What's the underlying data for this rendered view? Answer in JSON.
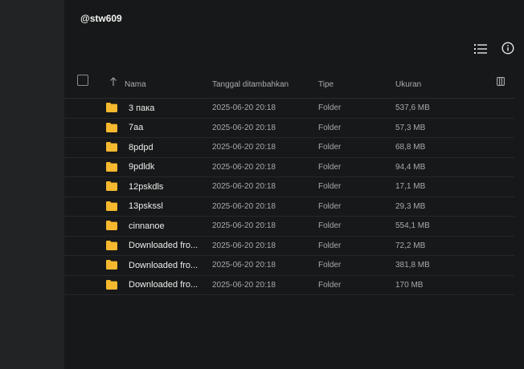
{
  "breadcrumb": {
    "current": "@stw609"
  },
  "toolbar": {
    "list_view_icon": "list-icon",
    "info_icon": "info-icon"
  },
  "table": {
    "columns": {
      "name": "Nama",
      "date": "Tanggal ditambahkan",
      "type": "Tipe",
      "size": "Ukuran"
    },
    "rows": [
      {
        "name": "3 пака",
        "date": "2025-06-20 20:18",
        "type": "Folder",
        "size": "537,6 MB"
      },
      {
        "name": "7aa",
        "date": "2025-06-20 20:18",
        "type": "Folder",
        "size": "57,3 MB"
      },
      {
        "name": "8pdpd",
        "date": "2025-06-20 20:18",
        "type": "Folder",
        "size": "68,8 MB"
      },
      {
        "name": "9pdldk",
        "date": "2025-06-20 20:18",
        "type": "Folder",
        "size": "94,4 MB"
      },
      {
        "name": "12pskdls",
        "date": "2025-06-20 20:18",
        "type": "Folder",
        "size": "17,1 MB"
      },
      {
        "name": "13pskssl",
        "date": "2025-06-20 20:18",
        "type": "Folder",
        "size": "29,3 MB"
      },
      {
        "name": "cinnanoe",
        "date": "2025-06-20 20:18",
        "type": "Folder",
        "size": "554,1 MB"
      },
      {
        "name": "Downloaded fro...",
        "date": "2025-06-20 20:18",
        "type": "Folder",
        "size": "72,2 MB"
      },
      {
        "name": "Downloaded fro...",
        "date": "2025-06-20 20:18",
        "type": "Folder",
        "size": "381,8 MB"
      },
      {
        "name": "Downloaded fro...",
        "date": "2025-06-20 20:18",
        "type": "Folder",
        "size": "170 MB"
      }
    ]
  },
  "colors": {
    "folder": "#f5b82e",
    "background": "#171819",
    "sidebar": "#222325"
  }
}
